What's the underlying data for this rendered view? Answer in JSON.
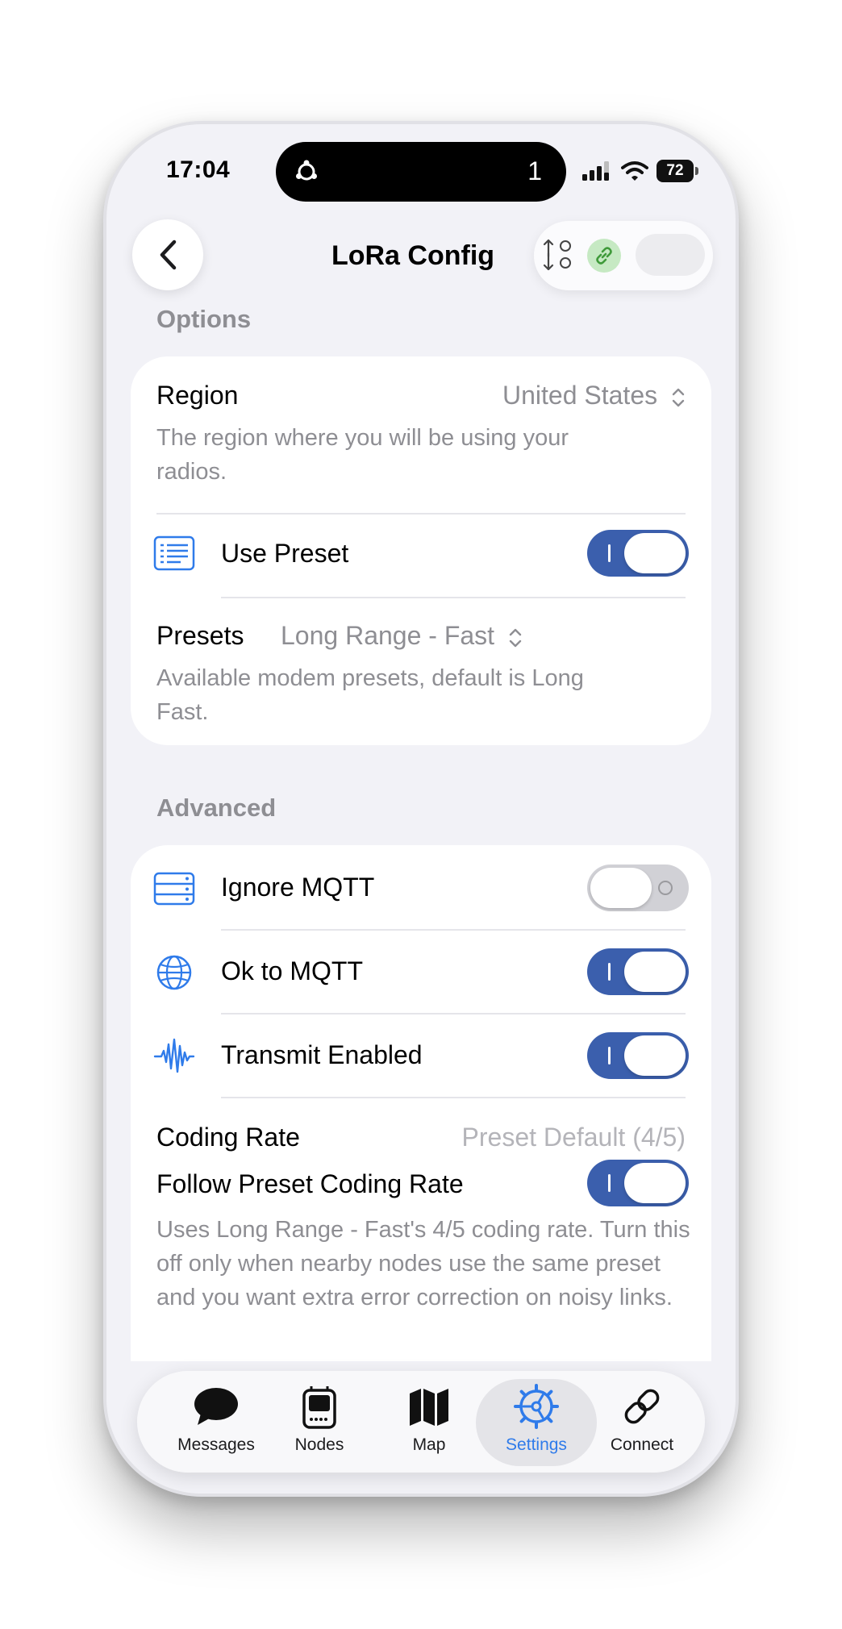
{
  "status_bar": {
    "time": "17:04",
    "island_count": "1",
    "battery": "72"
  },
  "nav": {
    "title": "LoRa Config",
    "back_icon": "chevron-left-icon",
    "sort_icon": "sort-icon",
    "link_icon": "link-icon"
  },
  "options": {
    "header": "Options",
    "region": {
      "label": "Region",
      "value": "United States",
      "description": "The region where you will be using your radios."
    },
    "use_preset": {
      "label": "Use Preset",
      "on": true,
      "icon": "list-icon"
    },
    "presets": {
      "label": "Presets",
      "value": "Long Range - Fast",
      "description": "Available modem presets, default is Long Fast."
    }
  },
  "advanced": {
    "header": "Advanced",
    "ignore_mqtt": {
      "label": "Ignore MQTT",
      "on": false,
      "icon": "server-icon"
    },
    "ok_to_mqtt": {
      "label": "Ok to MQTT",
      "on": true,
      "icon": "globe-icon"
    },
    "transmit_enabled": {
      "label": "Transmit Enabled",
      "on": true,
      "icon": "waveform-icon"
    },
    "coding_rate": {
      "label": "Coding Rate",
      "value": "Preset Default (4/5)"
    },
    "follow_preset_coding_rate": {
      "label": "Follow Preset Coding Rate",
      "on": true,
      "description": "Uses Long Range - Fast's 4/5 coding rate. Turn this off only when nearby nodes use the same preset and you want extra error correction on noisy links."
    }
  },
  "tabs": [
    {
      "label": "Messages",
      "icon": "chat-bubble-icon",
      "active": false
    },
    {
      "label": "Nodes",
      "icon": "radio-device-icon",
      "active": false
    },
    {
      "label": "Map",
      "icon": "map-icon",
      "active": false
    },
    {
      "label": "Settings",
      "icon": "gear-icon",
      "active": true
    },
    {
      "label": "Connect",
      "icon": "link-icon",
      "active": false
    }
  ],
  "colors": {
    "accent": "#3b5fad",
    "tab_active": "#2f7bea",
    "secondary_text": "#8e8e93",
    "background": "#f2f2f7"
  }
}
